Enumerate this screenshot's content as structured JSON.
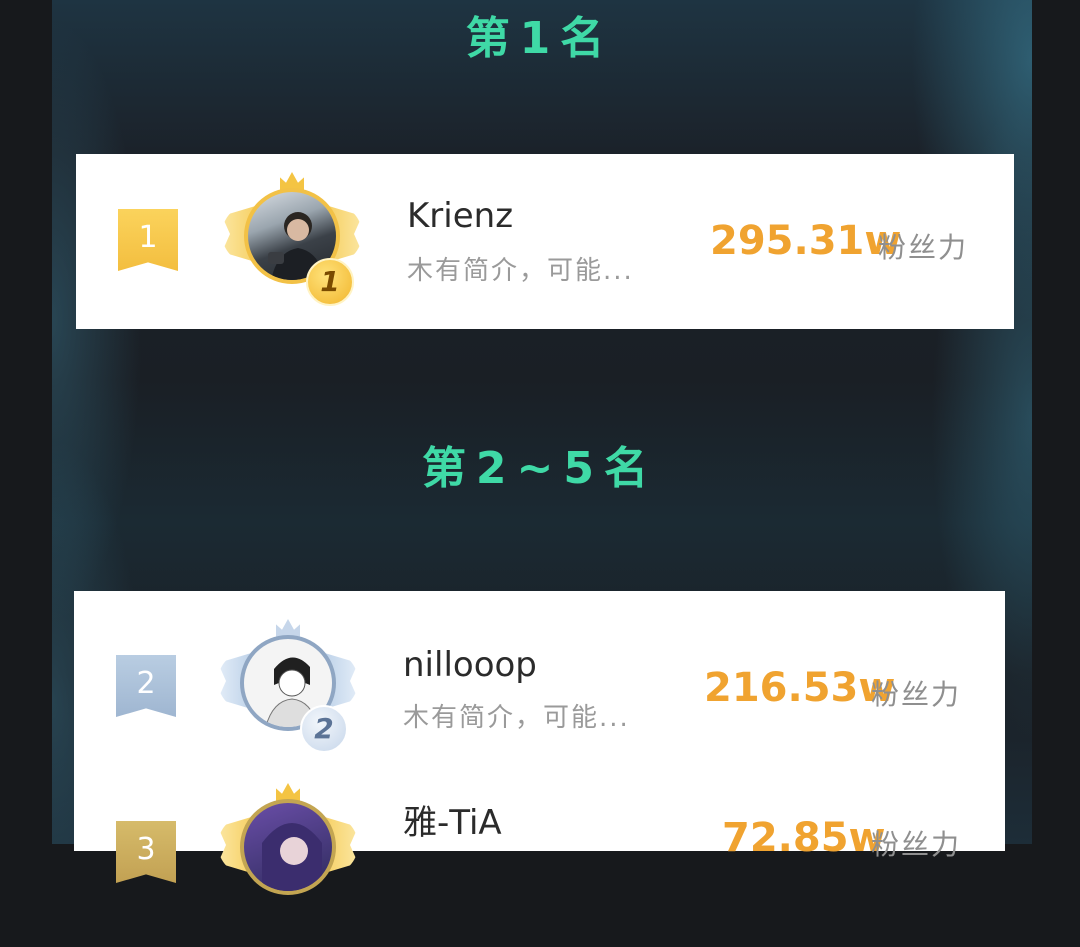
{
  "sections": {
    "top1_title": "第1名",
    "top2_5_title": "第2~5名"
  },
  "rankings": [
    {
      "rank": "1",
      "badge": "1",
      "name": "Krienz",
      "bio": "木有简介，可能...",
      "score": "295.31w",
      "unit": "粉丝力",
      "tier": "gold"
    },
    {
      "rank": "2",
      "badge": "2",
      "name": "nillooop",
      "bio": "木有简介，可能...",
      "score": "216.53w",
      "unit": "粉丝力",
      "tier": "silver"
    },
    {
      "rank": "3",
      "badge": "3",
      "name": "雅-TiA",
      "bio": "",
      "score": "72.85w",
      "unit": "粉丝力",
      "tier": "bronze"
    }
  ],
  "colors": {
    "title": "#3fd9a6",
    "score": "#f0a330",
    "gold_ribbon": "#f6c64a",
    "silver_ribbon": "#a9bfd9",
    "bronze_ribbon": "#c9ab5e"
  }
}
